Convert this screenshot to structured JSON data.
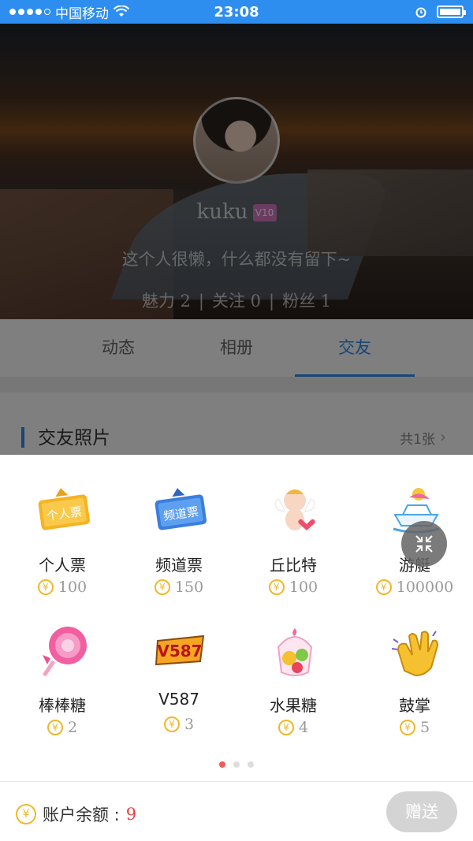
{
  "status_bar": {
    "carrier": "中国移动",
    "time": "23:08"
  },
  "profile": {
    "username": "kuku",
    "vip_badge": "V10",
    "bio": "这个人很懒，什么都没有留下~",
    "stats": {
      "charm": "魅力 2",
      "following": "关注 0",
      "fans": "粉丝 1"
    }
  },
  "tabs": [
    {
      "label": "动态"
    },
    {
      "label": "相册"
    },
    {
      "label": "交友"
    }
  ],
  "section": {
    "title": "交友照片",
    "count": "共1张"
  },
  "gifts": [
    {
      "name": "个人票",
      "price": "100",
      "icon": "ticket-personal-icon"
    },
    {
      "name": "频道票",
      "price": "150",
      "icon": "ticket-channel-icon"
    },
    {
      "name": "丘比特",
      "price": "100",
      "icon": "cupid-icon"
    },
    {
      "name": "游艇",
      "price": "100000",
      "icon": "yacht-icon"
    },
    {
      "name": "棒棒糖",
      "price": "2",
      "icon": "lollipop-icon"
    },
    {
      "name": "V587",
      "price": "3",
      "icon": "v587-icon"
    },
    {
      "name": "水果糖",
      "price": "4",
      "icon": "fruit-candy-icon"
    },
    {
      "name": "鼓掌",
      "price": "5",
      "icon": "clap-icon"
    }
  ],
  "ticket_labels": {
    "personal": "个人票",
    "channel": "频道票"
  },
  "v587_label": "V587",
  "pager": {
    "pages": 3,
    "current": 1
  },
  "footer": {
    "balance_label": "账户余额 :",
    "balance_value": "9",
    "send_label": "赠送"
  },
  "colors": {
    "accent": "#2d8ef0",
    "coin": "#f0b82a",
    "balance": "#e84040",
    "send_disabled": "#d4d4d4"
  }
}
